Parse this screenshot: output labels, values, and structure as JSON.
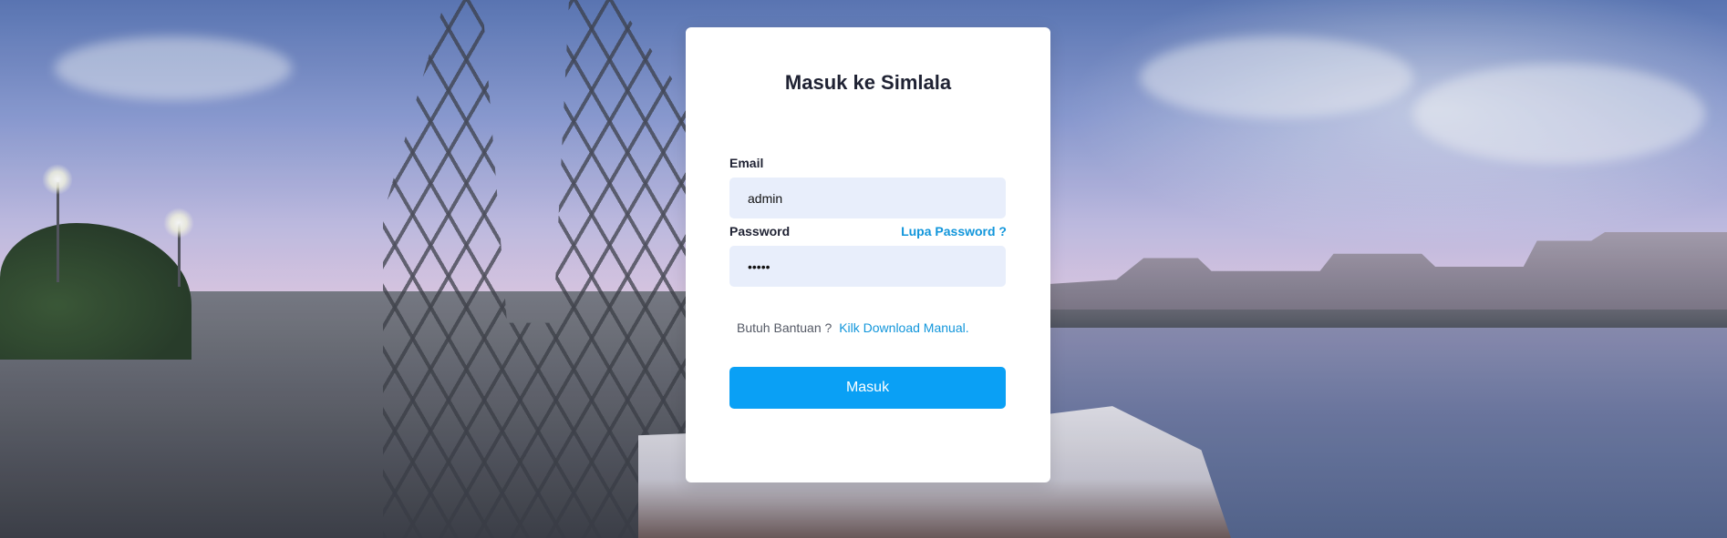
{
  "login": {
    "title": "Masuk ke Simlala",
    "email_label": "Email",
    "email_value": "admin",
    "password_label": "Password",
    "password_value": "•••••",
    "forgot_label": "Lupa Password ?",
    "help_text": "Butuh Bantuan ?",
    "help_link": "Kilk Download Manual.",
    "submit_label": "Masuk"
  },
  "colors": {
    "accent": "#0aa0f5",
    "link": "#1296db",
    "input_bg": "#e8eefb"
  }
}
